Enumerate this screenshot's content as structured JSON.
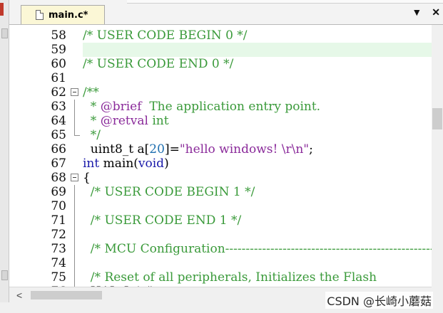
{
  "tab": {
    "label": "main.c*",
    "dropdown_icon": "chevron-down-icon",
    "close_icon": "close-icon"
  },
  "controls": {
    "dropdown": "▼",
    "close": "✕"
  },
  "lines": [
    {
      "num": "58",
      "fold": "none",
      "segments": [
        {
          "t": "/* USER CODE BEGIN 0 */",
          "c": "comment"
        }
      ]
    },
    {
      "num": "59",
      "fold": "none",
      "highlight": true,
      "segments": [
        {
          "t": "",
          "c": "plain"
        }
      ]
    },
    {
      "num": "60",
      "fold": "none",
      "segments": [
        {
          "t": "/* USER CODE END 0 */",
          "c": "comment"
        }
      ]
    },
    {
      "num": "61",
      "fold": "none",
      "segments": [
        {
          "t": "",
          "c": "plain"
        }
      ]
    },
    {
      "num": "62",
      "fold": "open",
      "segments": [
        {
          "t": "/**",
          "c": "comment"
        }
      ]
    },
    {
      "num": "63",
      "fold": "line",
      "segments": [
        {
          "t": "  * ",
          "c": "comment"
        },
        {
          "t": "@brief",
          "c": "doc"
        },
        {
          "t": "  The application entry point.",
          "c": "comment"
        }
      ]
    },
    {
      "num": "64",
      "fold": "line",
      "segments": [
        {
          "t": "  * ",
          "c": "comment"
        },
        {
          "t": "@retval",
          "c": "doc"
        },
        {
          "t": " int",
          "c": "comment"
        }
      ]
    },
    {
      "num": "65",
      "fold": "end",
      "segments": [
        {
          "t": "  */",
          "c": "comment"
        }
      ]
    },
    {
      "num": "66",
      "fold": "none",
      "segments": [
        {
          "t": "  uint8_t a[",
          "c": "plain"
        },
        {
          "t": "20",
          "c": "number"
        },
        {
          "t": "]=",
          "c": "plain"
        },
        {
          "t": "\"hello windows! \\r\\n\"",
          "c": "string"
        },
        {
          "t": ";",
          "c": "plain"
        }
      ]
    },
    {
      "num": "67",
      "fold": "none",
      "segments": [
        {
          "t": "int",
          "c": "keyword"
        },
        {
          "t": " main(",
          "c": "plain"
        },
        {
          "t": "void",
          "c": "keyword"
        },
        {
          "t": ")",
          "c": "plain"
        }
      ]
    },
    {
      "num": "68",
      "fold": "open",
      "segments": [
        {
          "t": "{",
          "c": "plain"
        }
      ]
    },
    {
      "num": "69",
      "fold": "line",
      "segments": [
        {
          "t": "  /* USER CODE BEGIN 1 */",
          "c": "comment"
        }
      ]
    },
    {
      "num": "70",
      "fold": "line",
      "segments": [
        {
          "t": "",
          "c": "plain"
        }
      ]
    },
    {
      "num": "71",
      "fold": "line",
      "segments": [
        {
          "t": "  /* USER CODE END 1 */",
          "c": "comment"
        }
      ]
    },
    {
      "num": "72",
      "fold": "line",
      "segments": [
        {
          "t": "",
          "c": "plain"
        }
      ]
    },
    {
      "num": "73",
      "fold": "line",
      "segments": [
        {
          "t": "  /* MCU Configuration--------------------------------------------------------",
          "c": "comment"
        }
      ]
    },
    {
      "num": "74",
      "fold": "line",
      "segments": [
        {
          "t": "",
          "c": "plain"
        }
      ]
    },
    {
      "num": "75",
      "fold": "line",
      "segments": [
        {
          "t": "  /* Reset of all peripherals, Initializes the Flash",
          "c": "comment"
        }
      ]
    },
    {
      "num": "76",
      "fold": "line",
      "segments": [
        {
          "t": "  HAL_Init();",
          "c": "plain"
        }
      ]
    }
  ],
  "colors": {
    "comment": "#3a9a3a",
    "keyword": "#1a1aaa",
    "string": "#8a2a9a",
    "number": "#1f6fb0",
    "doc": "#8a2a9a",
    "highlight": "#e6f8e8",
    "tab_bg": "#fbf7d6"
  },
  "scroll": {
    "left_arrow": "<"
  },
  "watermark": "CSDN @长崎小蘑菇"
}
